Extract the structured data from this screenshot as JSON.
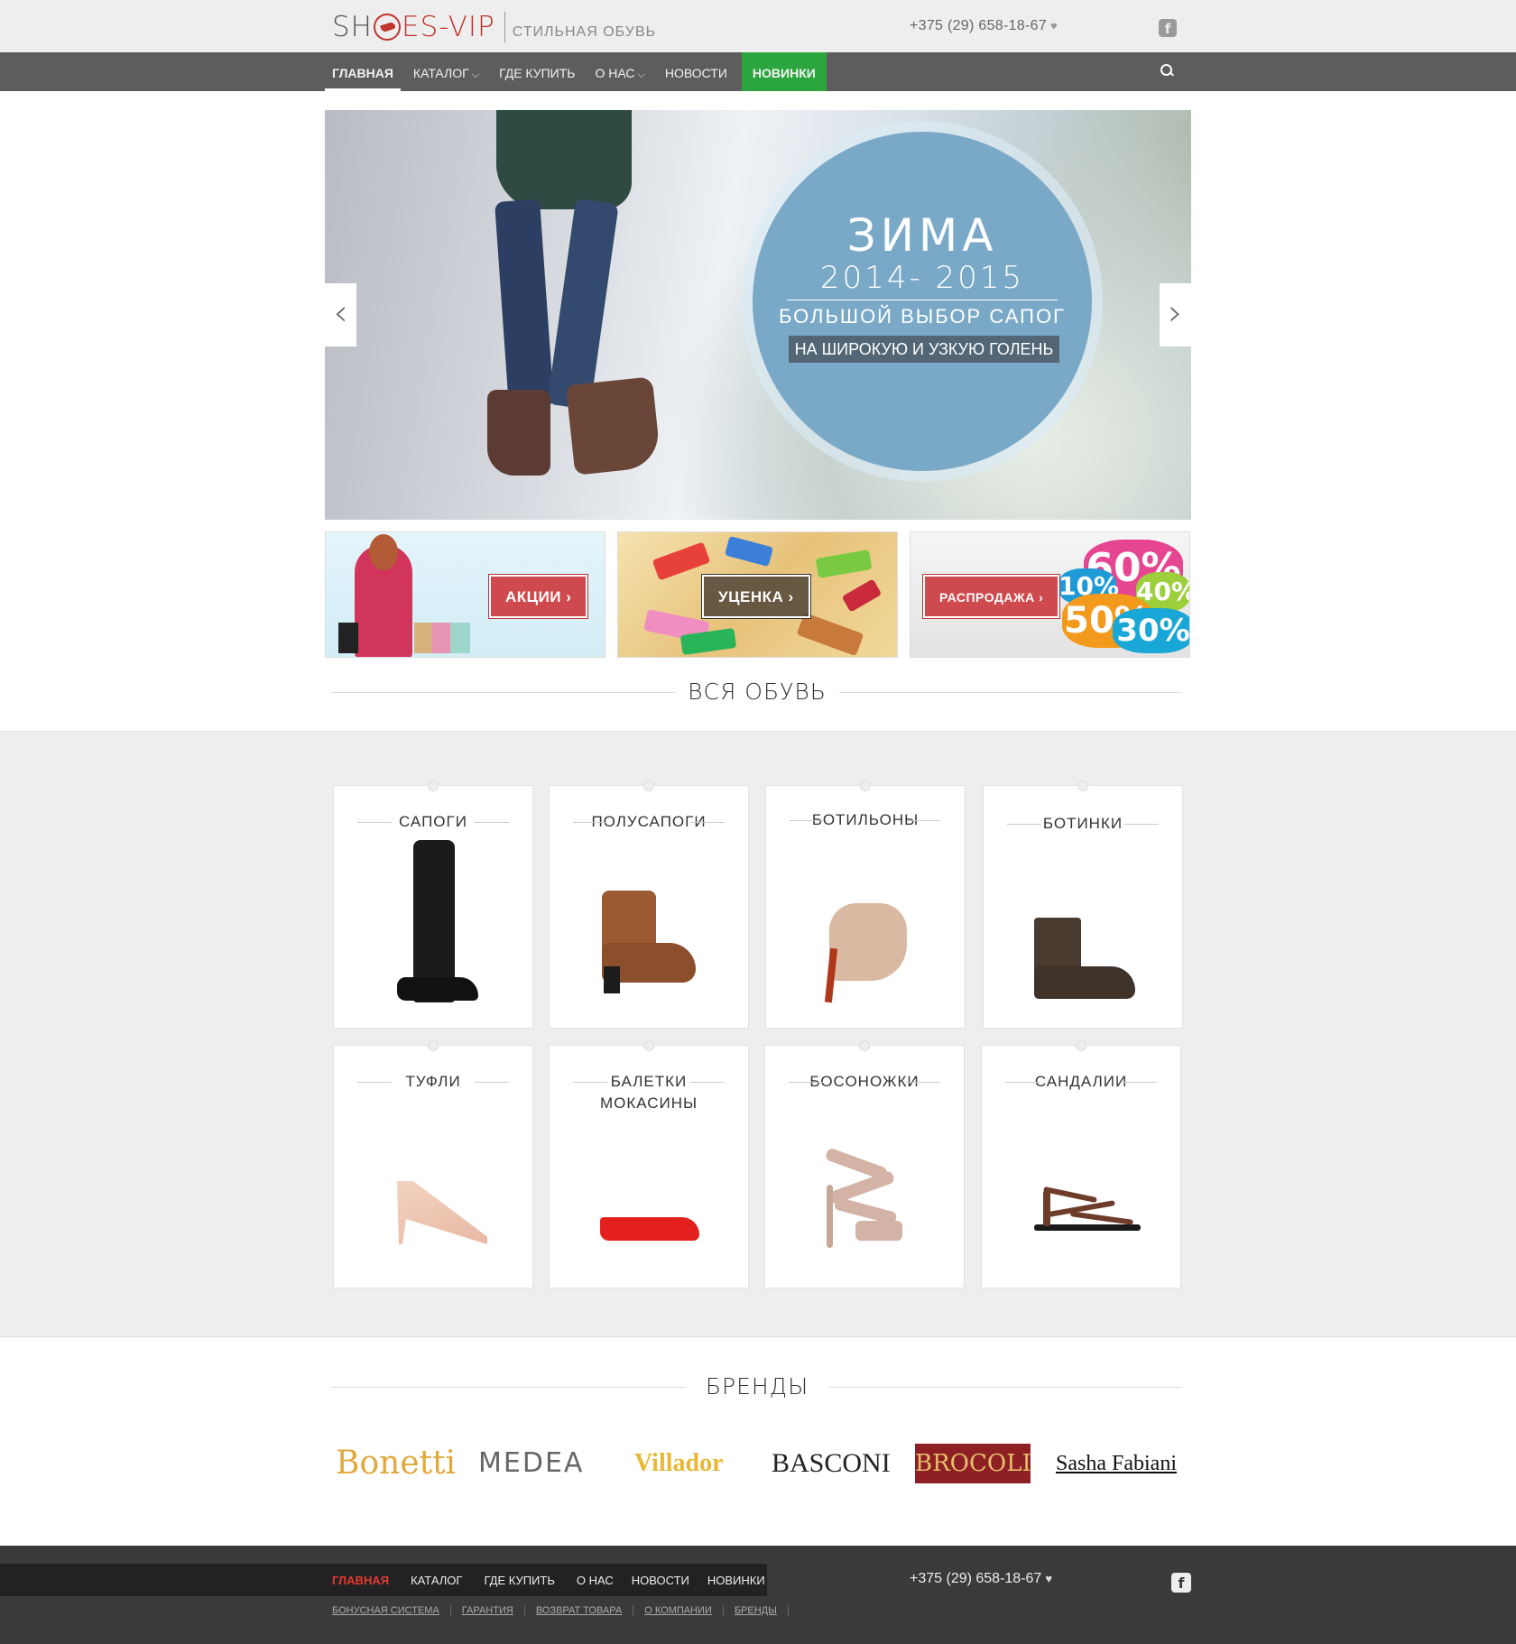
{
  "header": {
    "logo_text_left": "SH",
    "logo_text_right": "ES-VIP",
    "tagline": "СТИЛЬНАЯ ОБУВЬ",
    "phone": "+375 (29) 658-18-67",
    "heart_icon": "♥",
    "facebook_icon": "f"
  },
  "nav": {
    "items": [
      "ГЛАВНАЯ",
      "КАТАЛОГ",
      "ГДЕ КУПИТЬ",
      "О НАС",
      "НОВОСТИ",
      "НОВИНКИ"
    ],
    "chevron": "⌵"
  },
  "hero": {
    "title": "ЗИМА",
    "years": "2014- 2015",
    "subtitle": "БОЛЬШОЙ ВЫБОР САПОГ",
    "tag": "НА ШИРОКУЮ И УЗКУЮ ГОЛЕНЬ",
    "prev_arrow": "‹",
    "next_arrow": "›"
  },
  "promos": [
    {
      "label": "АКЦИИ ›"
    },
    {
      "label": "УЦЕНКА ›"
    },
    {
      "label": "РАСПРОДАЖА ›",
      "badges": [
        "60%",
        "10%",
        "50%",
        "30%",
        "40%"
      ]
    }
  ],
  "all_shoes": {
    "heading": "ВСЯ ОБУВЬ",
    "categories": [
      {
        "label": "САПОГИ"
      },
      {
        "label": "ПОЛУСАПОГИ"
      },
      {
        "label": "БОТИЛЬОНЫ"
      },
      {
        "label": "БОТИНКИ"
      },
      {
        "label": "ТУФЛИ"
      },
      {
        "label": "БАЛЕТКИ\nМОКАСИНЫ"
      },
      {
        "label": "БОСОНОЖКИ"
      },
      {
        "label": "САНДАЛИИ"
      }
    ]
  },
  "brands": {
    "heading": "БРЕНДЫ",
    "items": [
      "Bonetti",
      "MEDEA",
      "Villador",
      "BASCONI",
      "BROCOLI",
      "Sasha Fabiani"
    ]
  },
  "footer": {
    "nav": [
      "ГЛАВНАЯ",
      "КАТАЛОГ",
      "ГДЕ КУПИТЬ",
      "О НАС",
      "НОВОСТИ",
      "НОВИНКИ"
    ],
    "sub": [
      "БОНУСНАЯ СИСТЕМА",
      "ГАРАНТИЯ",
      "ВОЗВРАТ ТОВАРА",
      "О КОМПАНИИ",
      "БРЕНДЫ"
    ],
    "phone": "+375 (29) 658-18-67",
    "heart_icon": "♥",
    "facebook_icon": "f"
  },
  "colors": {
    "accent_red": "#c0342d",
    "new_green": "#2ba63e",
    "nav_grey": "#5d5d5d"
  }
}
